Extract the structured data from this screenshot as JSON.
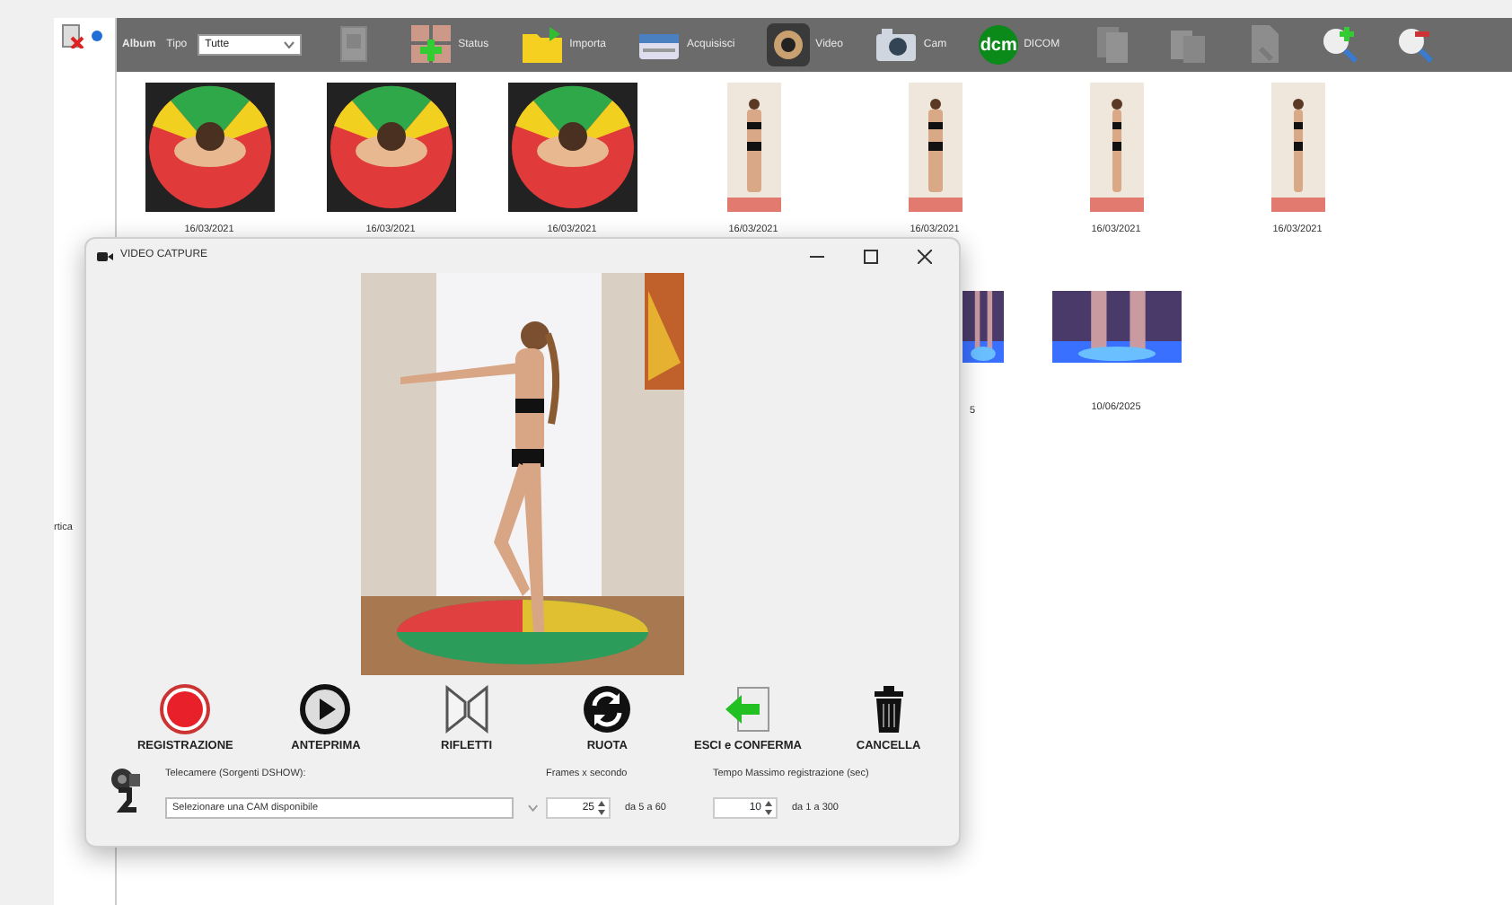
{
  "toolbar": {
    "album_label": "Album",
    "type_label": "Tipo",
    "type_select": "Tutte",
    "tools": [
      {
        "kind": "doc",
        "disabled": true
      },
      {
        "kind": "status",
        "label": "Status",
        "disabled": false
      },
      {
        "kind": "folder",
        "label": "Importa",
        "disabled": false
      },
      {
        "kind": "scanner",
        "label": "Acquisisci",
        "disabled": false
      },
      {
        "kind": "webcam",
        "label": "Video",
        "disabled": false
      },
      {
        "kind": "camera",
        "label": "Cam",
        "disabled": false
      },
      {
        "kind": "dicom",
        "badge": "dcm",
        "label": "DICOM",
        "disabled": false
      },
      {
        "kind": "pages",
        "disabled": true
      },
      {
        "kind": "copy",
        "disabled": true
      },
      {
        "kind": "file",
        "disabled": true
      },
      {
        "kind": "zoom-in",
        "disabled": false
      },
      {
        "kind": "zoom-out",
        "disabled": false
      }
    ]
  },
  "sidebar": {
    "text": "rtica"
  },
  "gallery": [
    {
      "kind": "target",
      "date": "16/03/2021"
    },
    {
      "kind": "target",
      "date": "16/03/2021"
    },
    {
      "kind": "target",
      "date": "16/03/2021"
    },
    {
      "kind": "front",
      "date": "16/03/2021"
    },
    {
      "kind": "front",
      "date": "16/03/2021"
    },
    {
      "kind": "side",
      "date": "16/03/2021"
    },
    {
      "kind": "side",
      "date": "16/03/2021"
    }
  ],
  "gallery_row_2": [
    {
      "kind": "partial",
      "date": "5"
    },
    {
      "kind": "feet",
      "date": "10/06/2025"
    }
  ],
  "dialog": {
    "title": "VIDEO CATPURE",
    "actions": [
      {
        "kind": "record",
        "label": "REGISTRAZIONE"
      },
      {
        "kind": "preview",
        "label": "ANTEPRIMA"
      },
      {
        "kind": "mirror",
        "label": "RIFLETTI"
      },
      {
        "kind": "rotate",
        "label": "RUOTA"
      },
      {
        "kind": "confirm",
        "label": "ESCI e CONFERMA"
      },
      {
        "kind": "delete",
        "label": "CANCELLA"
      }
    ],
    "camera": {
      "label": "Telecamere (Sorgenti DSHOW):",
      "value": "Selezionare una CAM disponibile"
    },
    "fps": {
      "label": "Frames x secondo",
      "value": "25",
      "range": "da 5 a 60"
    },
    "max_time": {
      "label": "Tempo Massimo registrazione (sec)",
      "value": "10",
      "range": "da 1 a 300"
    }
  }
}
